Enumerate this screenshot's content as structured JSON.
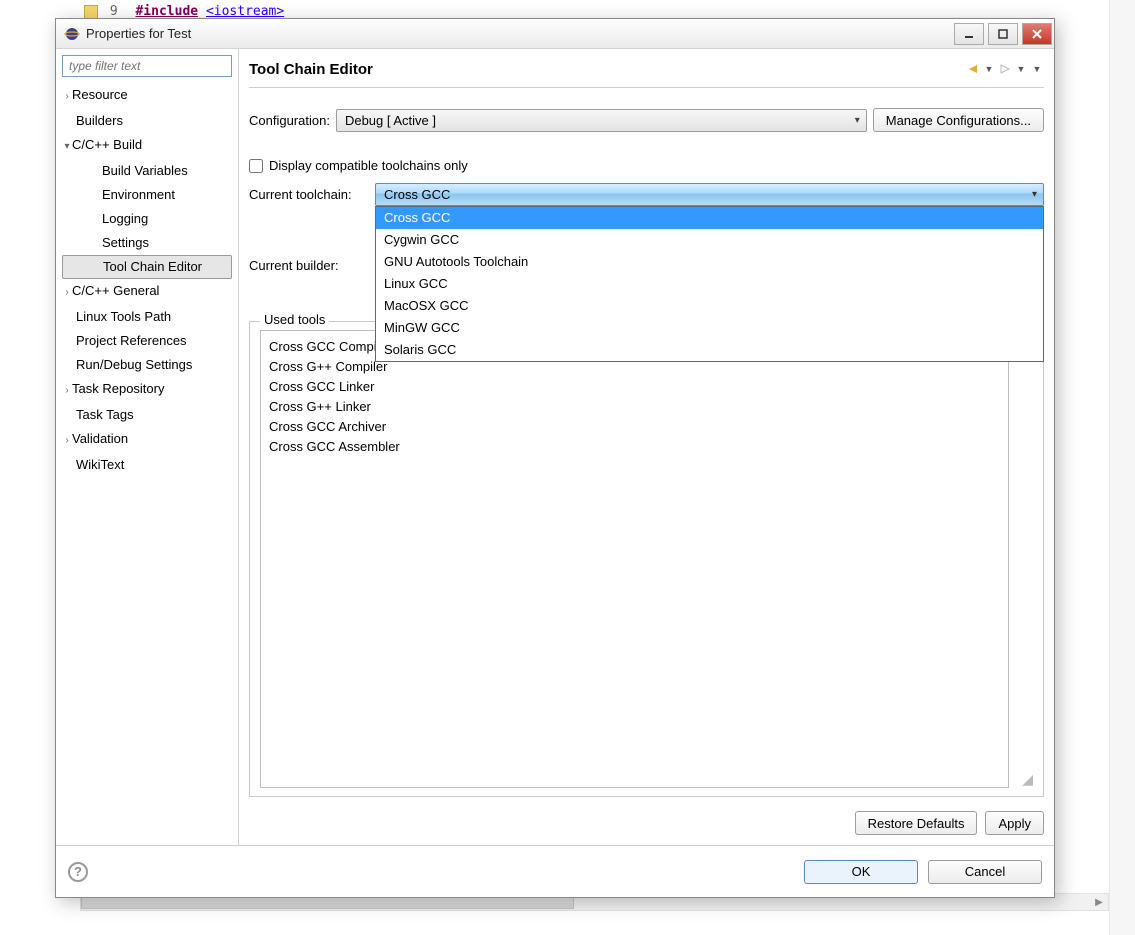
{
  "background": {
    "line_number": "9",
    "include_kw": "#include",
    "header": "<iostream>"
  },
  "titlebar": {
    "title": "Properties for Test"
  },
  "left": {
    "filter_placeholder": "type filter text",
    "tree": [
      {
        "label": "Resource",
        "depth": 0,
        "arrow": "›"
      },
      {
        "label": "Builders",
        "depth": 0,
        "arrow": ""
      },
      {
        "label": "C/C++ Build",
        "depth": 0,
        "arrow": "▾"
      },
      {
        "label": "Build Variables",
        "depth": 1,
        "arrow": ""
      },
      {
        "label": "Environment",
        "depth": 1,
        "arrow": ""
      },
      {
        "label": "Logging",
        "depth": 1,
        "arrow": ""
      },
      {
        "label": "Settings",
        "depth": 1,
        "arrow": ""
      },
      {
        "label": "Tool Chain Editor",
        "depth": 1,
        "arrow": "",
        "selected": true
      },
      {
        "label": "C/C++ General",
        "depth": 0,
        "arrow": "›"
      },
      {
        "label": "Linux Tools Path",
        "depth": 0,
        "arrow": ""
      },
      {
        "label": "Project References",
        "depth": 0,
        "arrow": ""
      },
      {
        "label": "Run/Debug Settings",
        "depth": 0,
        "arrow": ""
      },
      {
        "label": "Task Repository",
        "depth": 0,
        "arrow": "›"
      },
      {
        "label": "Task Tags",
        "depth": 0,
        "arrow": ""
      },
      {
        "label": "Validation",
        "depth": 0,
        "arrow": "›"
      },
      {
        "label": "WikiText",
        "depth": 0,
        "arrow": ""
      }
    ]
  },
  "main": {
    "title": "Tool Chain Editor",
    "config_label": "Configuration:",
    "config_value": "Debug  [ Active ]",
    "manage_btn": "Manage Configurations...",
    "display_compat": "Display compatible toolchains only",
    "toolchain_label": "Current toolchain:",
    "toolchain_value": "Cross GCC",
    "toolchain_options": [
      "Cross GCC",
      "Cygwin GCC",
      "GNU Autotools Toolchain",
      "Linux GCC",
      "MacOSX GCC",
      "MinGW GCC",
      "Solaris GCC"
    ],
    "builder_label": "Current builder:",
    "used_tools_legend": "Used tools",
    "used_tools": [
      "Cross GCC Compiler",
      "Cross G++ Compiler",
      "Cross GCC Linker",
      "Cross G++ Linker",
      "Cross GCC Archiver",
      "Cross GCC Assembler"
    ],
    "restore_btn": "Restore Defaults",
    "apply_btn": "Apply"
  },
  "footer": {
    "ok": "OK",
    "cancel": "Cancel"
  }
}
